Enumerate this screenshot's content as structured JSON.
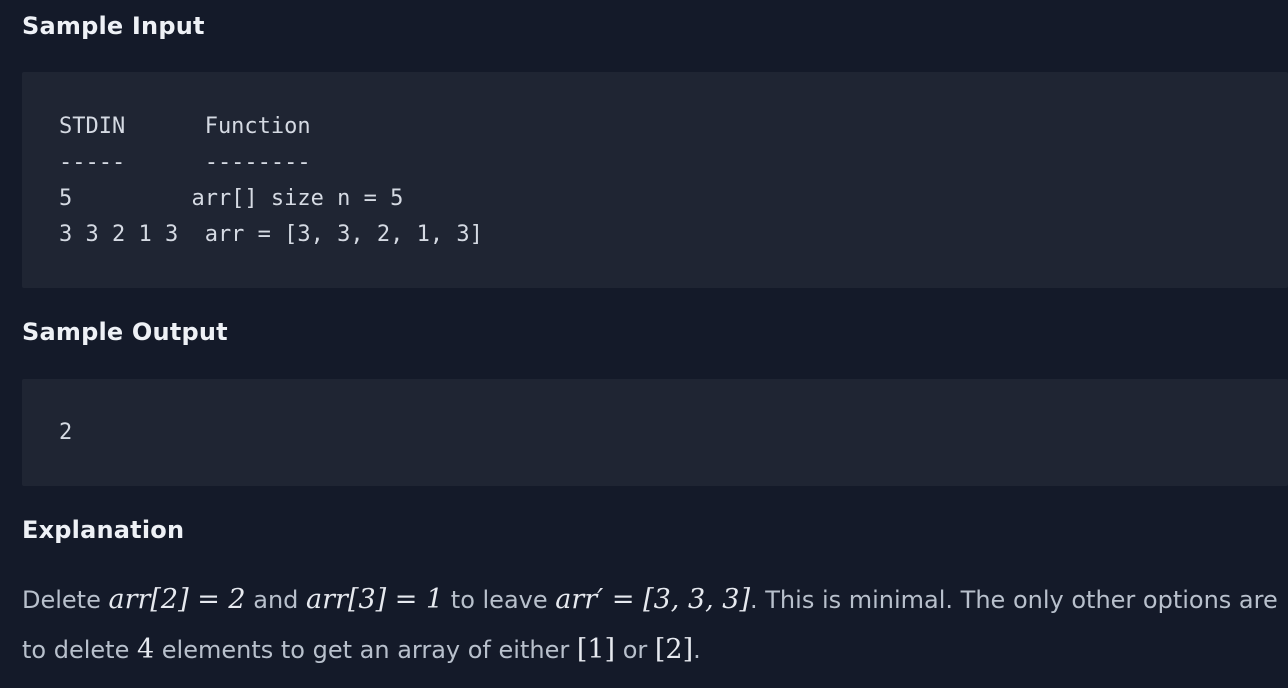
{
  "sample_input": {
    "heading": "Sample Input",
    "lines": [
      "STDIN      Function",
      "-----      --------",
      "5         arr[] size n = 5",
      "3 3 2 1 3  arr = [3, 3, 2, 1, 3]"
    ]
  },
  "sample_output": {
    "heading": "Sample Output",
    "lines": [
      "2"
    ]
  },
  "explanation": {
    "heading": "Explanation",
    "t1": "Delete ",
    "m1": "arr[2] = 2",
    "t2": " and ",
    "m2": "arr[3] = 1",
    "t3": " to leave ",
    "m3": "arr′ = [3, 3, 3]",
    "t4": ". This is minimal. The only other options are to delete ",
    "m4": "4",
    "t5": " elements to get an array of either ",
    "m5": "[1]",
    "t6": " or ",
    "m6": "[2]",
    "t7": "."
  }
}
